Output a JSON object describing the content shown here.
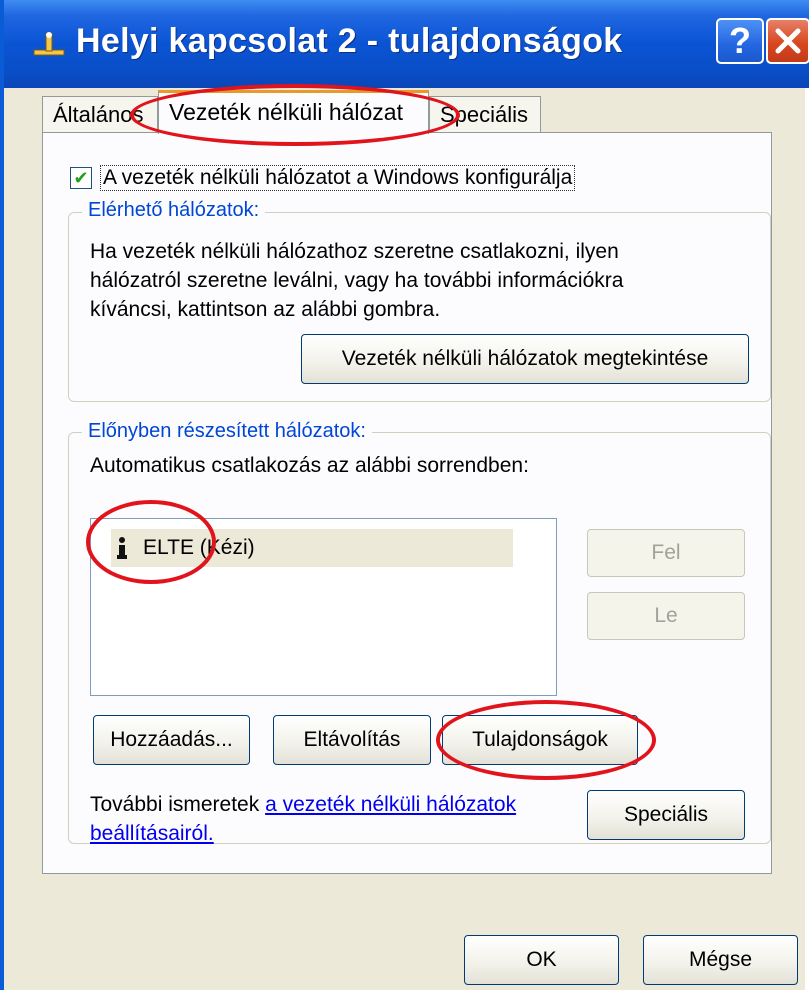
{
  "window": {
    "title": "Helyi kapcsolat 2 - tulajdonságok",
    "help_glyph": "?",
    "close_glyph": "✕",
    "icon": "network-connection-icon"
  },
  "tabs": [
    {
      "label": "Általános"
    },
    {
      "label": "Vezeték nélküli hálózat",
      "active": true
    },
    {
      "label": "Speciális"
    }
  ],
  "wireless": {
    "checkbox_label": "A vezeték nélküli hálózatot a Windows konfigurálja",
    "checkbox_checked": true,
    "available": {
      "legend": "Elérhető hálózatok:",
      "description_lines": [
        "Ha vezeték nélküli hálózathoz szeretne csatlakozni, ilyen",
        "hálózatról szeretne leválni, vagy ha további információkra",
        "kíváncsi, kattintson az alábbi gombra."
      ],
      "view_button": "Vezeték nélküli hálózatok megtekintése"
    },
    "preferred": {
      "legend": "Előnyben részesített hálózatok:",
      "subtitle": "Automatikus csatlakozás az alábbi sorrendben:",
      "networks": [
        {
          "label": "ELTE (Kézi)",
          "icon": "manual-network-icon"
        }
      ],
      "up_button": "Fel",
      "down_button": "Le",
      "add_button": "Hozzáadás...",
      "remove_button": "Eltávolítás",
      "properties_button": "Tulajdonságok"
    },
    "more_info": {
      "text": "További ismeretek ",
      "link_part1": "a vezeték nélküli hálózatok",
      "link_part2": "beállításairól."
    },
    "advanced_button": "Speciális"
  },
  "footer": {
    "ok_button": "OK",
    "cancel_button": "Mégse"
  },
  "annotations": {
    "color": "#e1141c"
  }
}
